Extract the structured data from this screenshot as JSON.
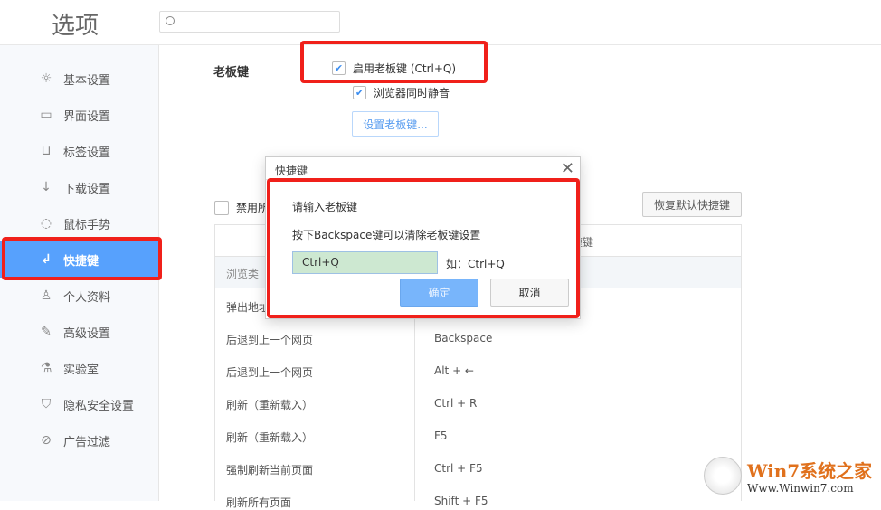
{
  "header": {
    "title": "选项",
    "search_placeholder": ""
  },
  "sidebar": {
    "items": [
      {
        "label": "基本设置",
        "icon": "☼",
        "name": "gear"
      },
      {
        "label": "界面设置",
        "icon": "▭",
        "name": "window"
      },
      {
        "label": "标签设置",
        "icon": "⊔",
        "name": "tab"
      },
      {
        "label": "下载设置",
        "icon": "↓",
        "name": "download"
      },
      {
        "label": "鼠标手势",
        "icon": "◌",
        "name": "mouse"
      },
      {
        "label": "快捷键",
        "icon": "↲",
        "name": "keyboard"
      },
      {
        "label": "个人资料",
        "icon": "♙",
        "name": "user"
      },
      {
        "label": "高级设置",
        "icon": "✎",
        "name": "wrench"
      },
      {
        "label": "实验室",
        "icon": "⚗",
        "name": "flask"
      },
      {
        "label": "隐私安全设置",
        "icon": "⛉",
        "name": "shield"
      },
      {
        "label": "广告过滤",
        "icon": "⊘",
        "name": "block"
      }
    ],
    "active_index": 5
  },
  "boss_key": {
    "section_label": "老板键",
    "enable_label": "启用老板键 (Ctrl+Q)",
    "enable_checked": true,
    "mute_label": "浏览器同时静音",
    "mute_checked": true,
    "set_button": "设置老板键..."
  },
  "shortcuts": {
    "disable_all_label": "禁用所",
    "restore_button": "恢复默认快捷键",
    "col_shortcut": "快捷键",
    "category": "浏览类",
    "rows": [
      {
        "action": "弹出地址",
        "key": ""
      },
      {
        "action": "后退到上一个网页",
        "key": "Backspace"
      },
      {
        "action": "后退到上一个网页",
        "key": "Alt + ←"
      },
      {
        "action": "刷新（重新载入）",
        "key": "Ctrl + R"
      },
      {
        "action": "刷新（重新载入）",
        "key": "F5"
      },
      {
        "action": "强制刷新当前页面",
        "key": "Ctrl + F5"
      },
      {
        "action": "刷新所有页面",
        "key": "Shift + F5"
      }
    ]
  },
  "dialog": {
    "title": "快捷键",
    "prompt": "请输入老板键",
    "hint": "按下Backspace键可以清除老板键设置",
    "input_value": "Ctrl+Q",
    "example": "如：Ctrl+Q",
    "ok": "确定",
    "cancel": "取消"
  },
  "watermark": {
    "text": "Win7系统之家",
    "url": "Www.Winwin7.com"
  }
}
